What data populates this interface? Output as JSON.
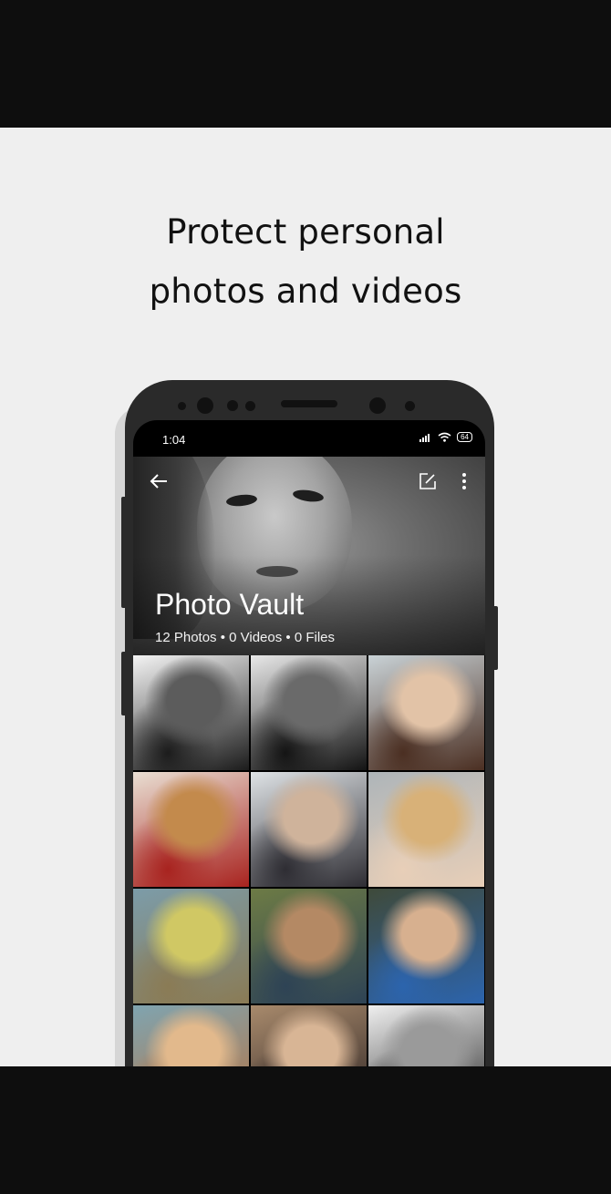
{
  "headline": {
    "line1": "Protect personal",
    "line2": "photos and videos"
  },
  "status_bar": {
    "time": "1:04",
    "battery": "64"
  },
  "toolbar": {
    "back_icon": "arrow-left-icon",
    "edit_icon": "edit-square-icon",
    "more_icon": "more-vertical-icon"
  },
  "vault": {
    "title": "Photo Vault",
    "summary": "12 Photos • 0 Videos • 0 Files"
  },
  "colors": {
    "stage_bg": "#efefef",
    "frame": "#0e0e0e",
    "phone_body": "#2a2a2a",
    "text_dark": "#111111"
  },
  "photos": [
    {
      "name": "photo-1",
      "palette": [
        "#f4f4f4",
        "#5c5c5c",
        "#1c1c1c"
      ]
    },
    {
      "name": "photo-2",
      "palette": [
        "#e8e8e8",
        "#6a6a6a",
        "#141414"
      ]
    },
    {
      "name": "photo-3",
      "palette": [
        "#c9d2d6",
        "#e2c3a7",
        "#4b2f22"
      ]
    },
    {
      "name": "photo-4",
      "palette": [
        "#e9dfd3",
        "#c38a4c",
        "#a8231f"
      ]
    },
    {
      "name": "photo-5",
      "palette": [
        "#dfe3e6",
        "#cfb39b",
        "#2e2d33"
      ]
    },
    {
      "name": "photo-6",
      "palette": [
        "#aeb5b9",
        "#d8b178",
        "#e8cfb8"
      ]
    },
    {
      "name": "photo-7",
      "palette": [
        "#7c9ca9",
        "#d0c864",
        "#8a7b55"
      ]
    },
    {
      "name": "photo-8",
      "palette": [
        "#6d7b45",
        "#b48964",
        "#2e4355"
      ]
    },
    {
      "name": "photo-9",
      "palette": [
        "#3f4a3a",
        "#d7b08f",
        "#2c64ad"
      ]
    },
    {
      "name": "photo-10",
      "palette": [
        "#7fa4b0",
        "#e2b98c",
        "#b77443"
      ]
    },
    {
      "name": "photo-11",
      "palette": [
        "#a88a6c",
        "#d8b595",
        "#2b2222"
      ]
    },
    {
      "name": "photo-12",
      "palette": [
        "#efefef",
        "#9a9a9a",
        "#2b2b2b"
      ]
    }
  ]
}
